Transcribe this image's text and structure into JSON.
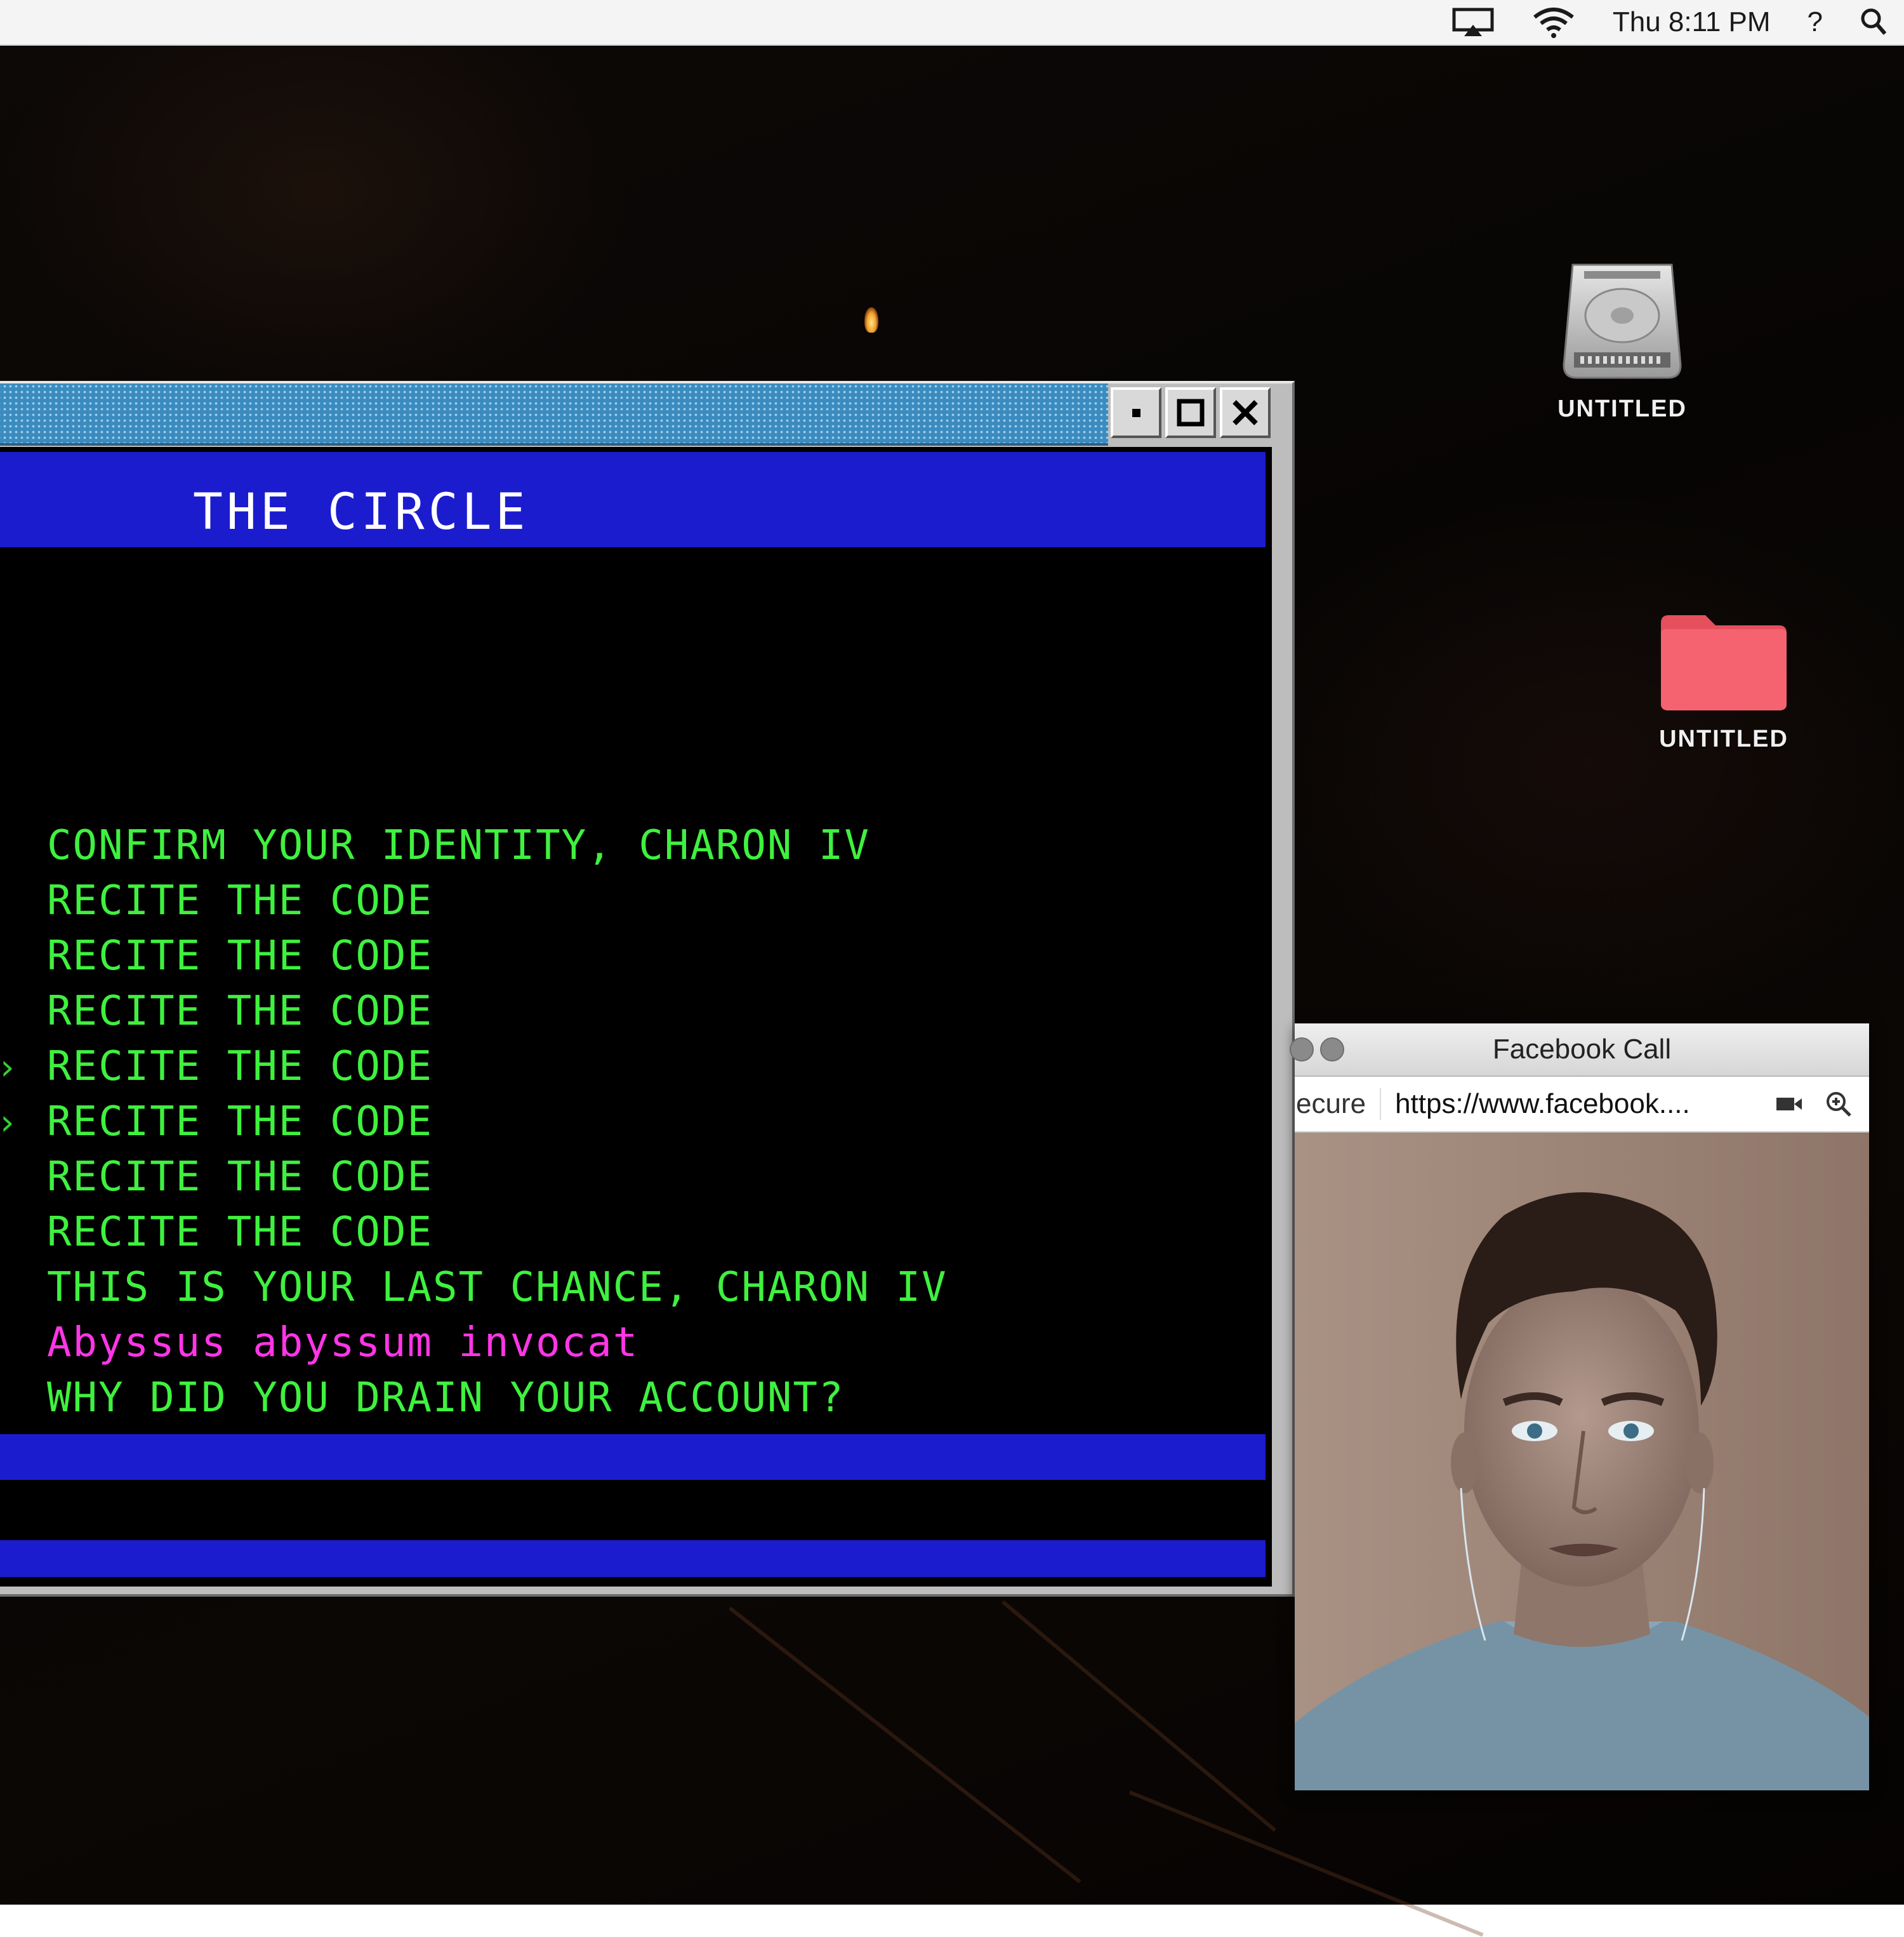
{
  "menubar": {
    "clock": "Thu 8:11 PM",
    "help": "?",
    "icons": [
      "airplay-icon",
      "wifi-icon",
      "spotlight-icon"
    ]
  },
  "desktop": {
    "icons": [
      {
        "label": "UNTITLED",
        "icon": "hard-drive-icon"
      },
      {
        "label": "UNTITLED",
        "icon": "folder-icon",
        "color": "#f4636f"
      }
    ]
  },
  "terminal": {
    "title": "THE CIRCLE",
    "controls": [
      "minimize-icon",
      "maximize-icon",
      "close-icon"
    ],
    "lines": [
      {
        "text": "CONFIRM YOUR IDENTITY, CHARON IV",
        "color": "#3ff13f"
      },
      {
        "text": "RECITE THE CODE",
        "color": "#3ff13f"
      },
      {
        "text": "RECITE THE CODE",
        "color": "#3ff13f"
      },
      {
        "text": "RECITE THE CODE",
        "color": "#3ff13f"
      },
      {
        "text": "RECITE THE CODE",
        "color": "#3ff13f"
      },
      {
        "text": "RECITE THE CODE",
        "color": "#3ff13f"
      },
      {
        "text": "RECITE THE CODE",
        "color": "#3ff13f"
      },
      {
        "text": "RECITE THE CODE",
        "color": "#3ff13f"
      },
      {
        "text": "THIS IS YOUR LAST CHANCE, CHARON IV",
        "color": "#3ff13f"
      },
      {
        "text": "Abyssus abyssum invocat",
        "color": "#ff35e6"
      },
      {
        "text": "WHY DID YOU DRAIN YOUR ACCOUNT?",
        "color": "#3ff13f"
      }
    ],
    "accent": "#1c1ccf",
    "text_color": "#3ff13f"
  },
  "facebook_call": {
    "title": "Facebook Call",
    "secure_label": "ecure",
    "url": "https://www.facebook....",
    "icons": [
      "video-camera-icon",
      "zoom-icon"
    ]
  }
}
